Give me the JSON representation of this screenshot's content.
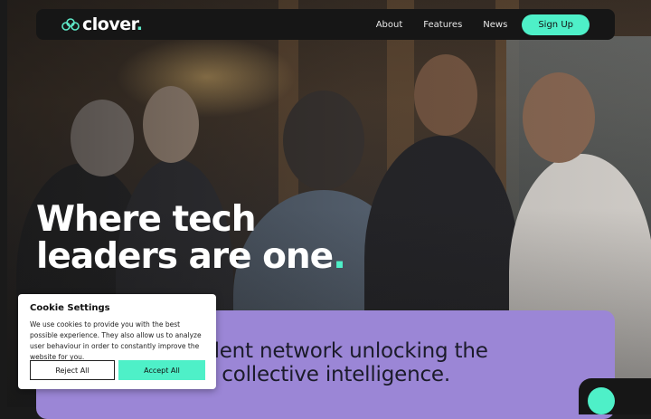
{
  "brand": {
    "name": "clover",
    "dot": ".",
    "accent_color": "#4ef0c8",
    "logo_icon": "clover-rings-icon"
  },
  "nav": {
    "links": [
      "About",
      "Features",
      "News"
    ],
    "signup_label": "Sign Up"
  },
  "hero": {
    "headline_line1": "Where tech",
    "headline_line2": "leaders are one",
    "headline_dot": ".",
    "tagline_line1": "endent network unlocking the",
    "tagline_line2": "r of collective intelligence."
  },
  "cookie": {
    "title": "Cookie Settings",
    "text": "We use cookies to provide you with the best possible experience. They also allow us to analyze user behaviour in order to constantly improve the website for you.",
    "reject_label": "Reject All",
    "accept_label": "Accept All"
  },
  "colors": {
    "card_purple": "#9b86d6",
    "nav_bg": "#161616"
  }
}
